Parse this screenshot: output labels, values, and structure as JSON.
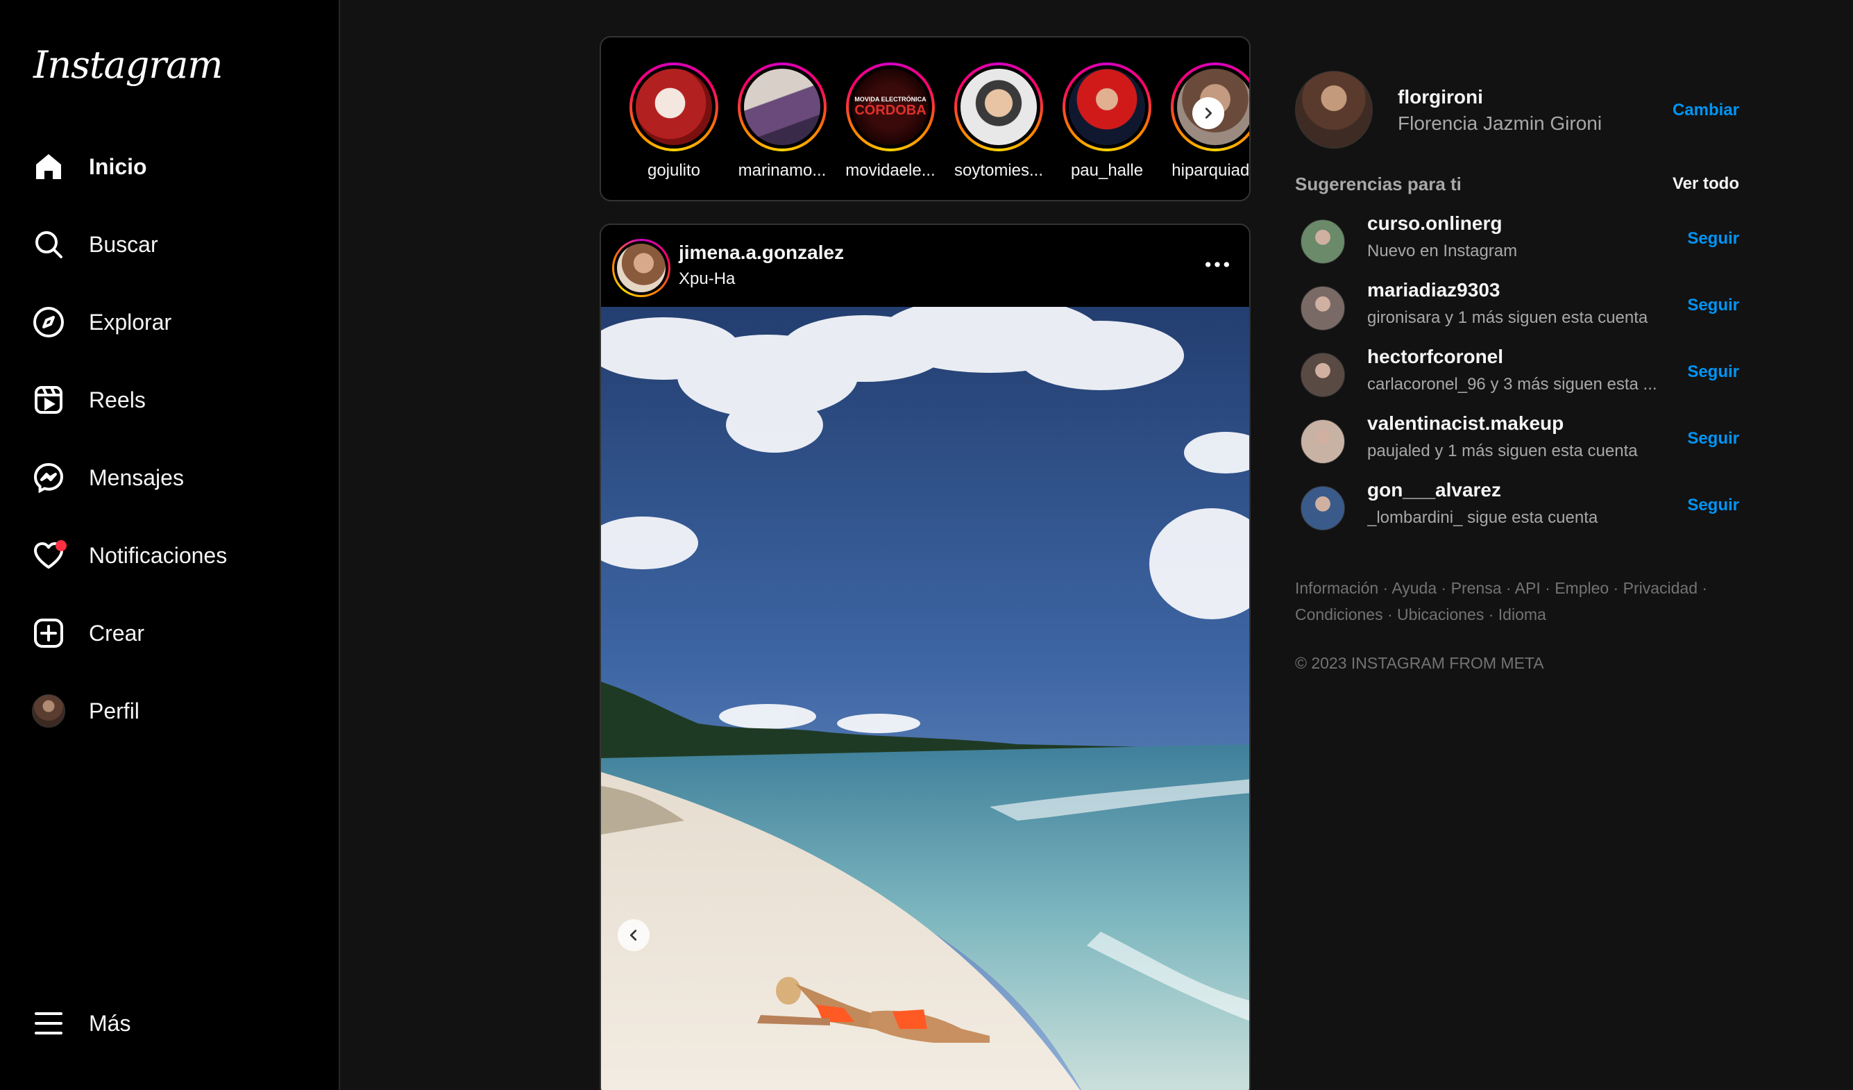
{
  "app": {
    "logo": "Instagram"
  },
  "nav": [
    {
      "id": "home",
      "label": "Inicio",
      "icon": "home-icon"
    },
    {
      "id": "search",
      "label": "Buscar",
      "icon": "search-icon"
    },
    {
      "id": "explore",
      "label": "Explorar",
      "icon": "compass-icon"
    },
    {
      "id": "reels",
      "label": "Reels",
      "icon": "reels-icon"
    },
    {
      "id": "messages",
      "label": "Mensajes",
      "icon": "messenger-icon"
    },
    {
      "id": "notifications",
      "label": "Notificaciones",
      "icon": "heart-icon"
    },
    {
      "id": "create",
      "label": "Crear",
      "icon": "plus-square-icon"
    },
    {
      "id": "profile",
      "label": "Perfil",
      "icon": "avatar"
    },
    {
      "id": "more",
      "label": "Más",
      "icon": "menu-icon"
    }
  ],
  "stories": [
    {
      "username": "gojulito"
    },
    {
      "username": "marinamo..."
    },
    {
      "username": "movidaele..."
    },
    {
      "username": "soytomies..."
    },
    {
      "username": "pau_halle"
    },
    {
      "username": "hiparquiado"
    }
  ],
  "story_thumb_text": {
    "line1": "MOVIDA ELECTRÓNICA",
    "line2": "CÓRDOBA"
  },
  "post": {
    "username": "jimena.a.gonzalez",
    "location": "Xpu-Ha"
  },
  "me": {
    "username": "florgironi",
    "fullname": "Florencia Jazmin Gironi",
    "switch_label": "Cambiar"
  },
  "suggestions": {
    "title": "Sugerencias para ti",
    "see_all": "Ver todo",
    "follow_label": "Seguir",
    "items": [
      {
        "username": "curso.onlinerg",
        "subtitle": "Nuevo en Instagram",
        "color": "#6a8a6a"
      },
      {
        "username": "mariadiaz9303",
        "subtitle": "gironisara y 1 más siguen esta cuenta",
        "color": "#7a6a66"
      },
      {
        "username": "hectorfcoronel",
        "subtitle": "carlacoronel_96 y 3 más siguen esta ...",
        "color": "#5a4a44"
      },
      {
        "username": "valentinacist.makeup",
        "subtitle": "paujaled y 1 más siguen esta cuenta",
        "color": "#c8b2a4"
      },
      {
        "username": "gon___alvarez",
        "subtitle": "_lombardini_ sigue esta cuenta",
        "color": "#3a5a8a"
      }
    ]
  },
  "footer": {
    "links": [
      "Información",
      "Ayuda",
      "Prensa",
      "API",
      "Empleo",
      "Privacidad",
      "Condiciones",
      "Ubicaciones",
      "Idioma"
    ],
    "copyright": "© 2023 INSTAGRAM FROM META"
  }
}
